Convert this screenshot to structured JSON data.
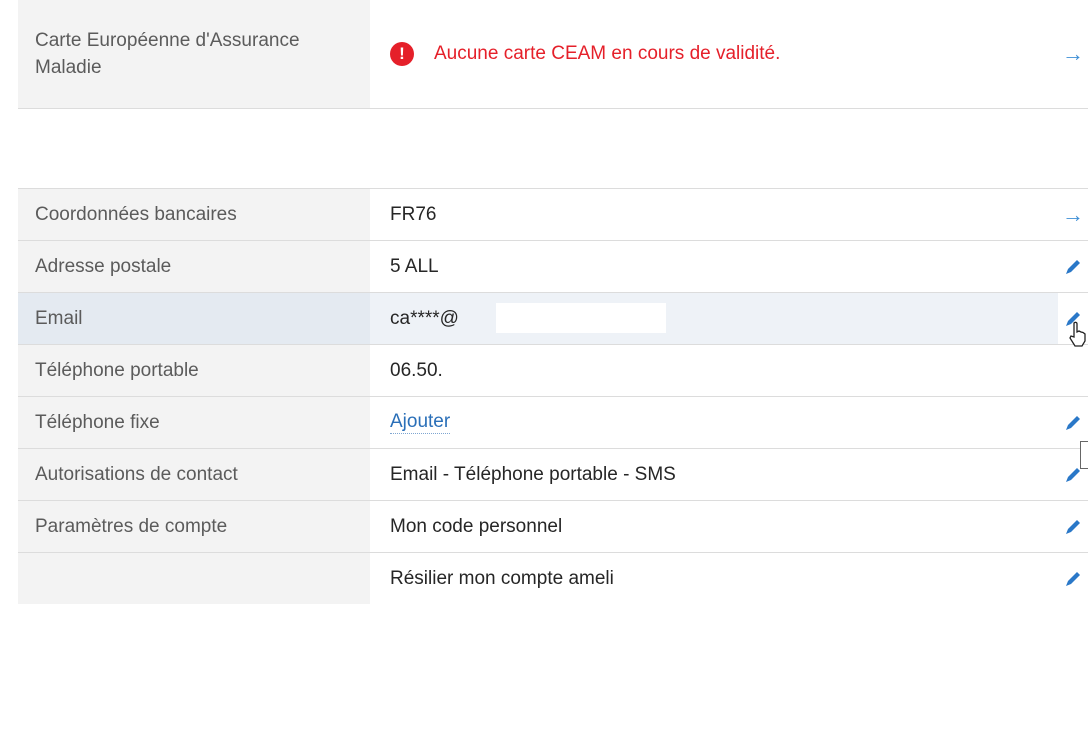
{
  "ceam": {
    "label": "Carte Européenne d'Assurance Maladie",
    "message": "Aucune carte CEAM en cours de validité.",
    "alert_icon": "!",
    "alert_color": "#e5202a"
  },
  "rows": [
    {
      "label": "Coordonnées bancaires",
      "value": "FR76",
      "action_icon": "arrow-right-icon"
    },
    {
      "label": "Adresse postale",
      "value": "5 ALL",
      "action_icon": "pencil-icon"
    },
    {
      "label": "Email",
      "value": "ca****@",
      "action_icon": "pencil-icon"
    },
    {
      "label": "Téléphone portable",
      "value": "06.50.",
      "action_icon": "pencil-icon"
    },
    {
      "label": "Téléphone fixe",
      "value": "Ajouter",
      "action_icon": "pencil-icon"
    },
    {
      "label": "Autorisations de contact",
      "value": "Email - Téléphone portable - SMS",
      "action_icon": "pencil-icon"
    },
    {
      "label": "Paramètres de compte",
      "value": "Mon code personnel",
      "action_icon": "pencil-icon"
    },
    {
      "label": "",
      "value": "Résilier mon compte ameli",
      "action_icon": "pencil-icon"
    }
  ],
  "arrow_glyph": "→",
  "colors": {
    "link": "#2a6fb8",
    "arrow": "#3f8fd6",
    "label_bg": "#f3f3f3",
    "hover_bg": "#eef2f7"
  }
}
